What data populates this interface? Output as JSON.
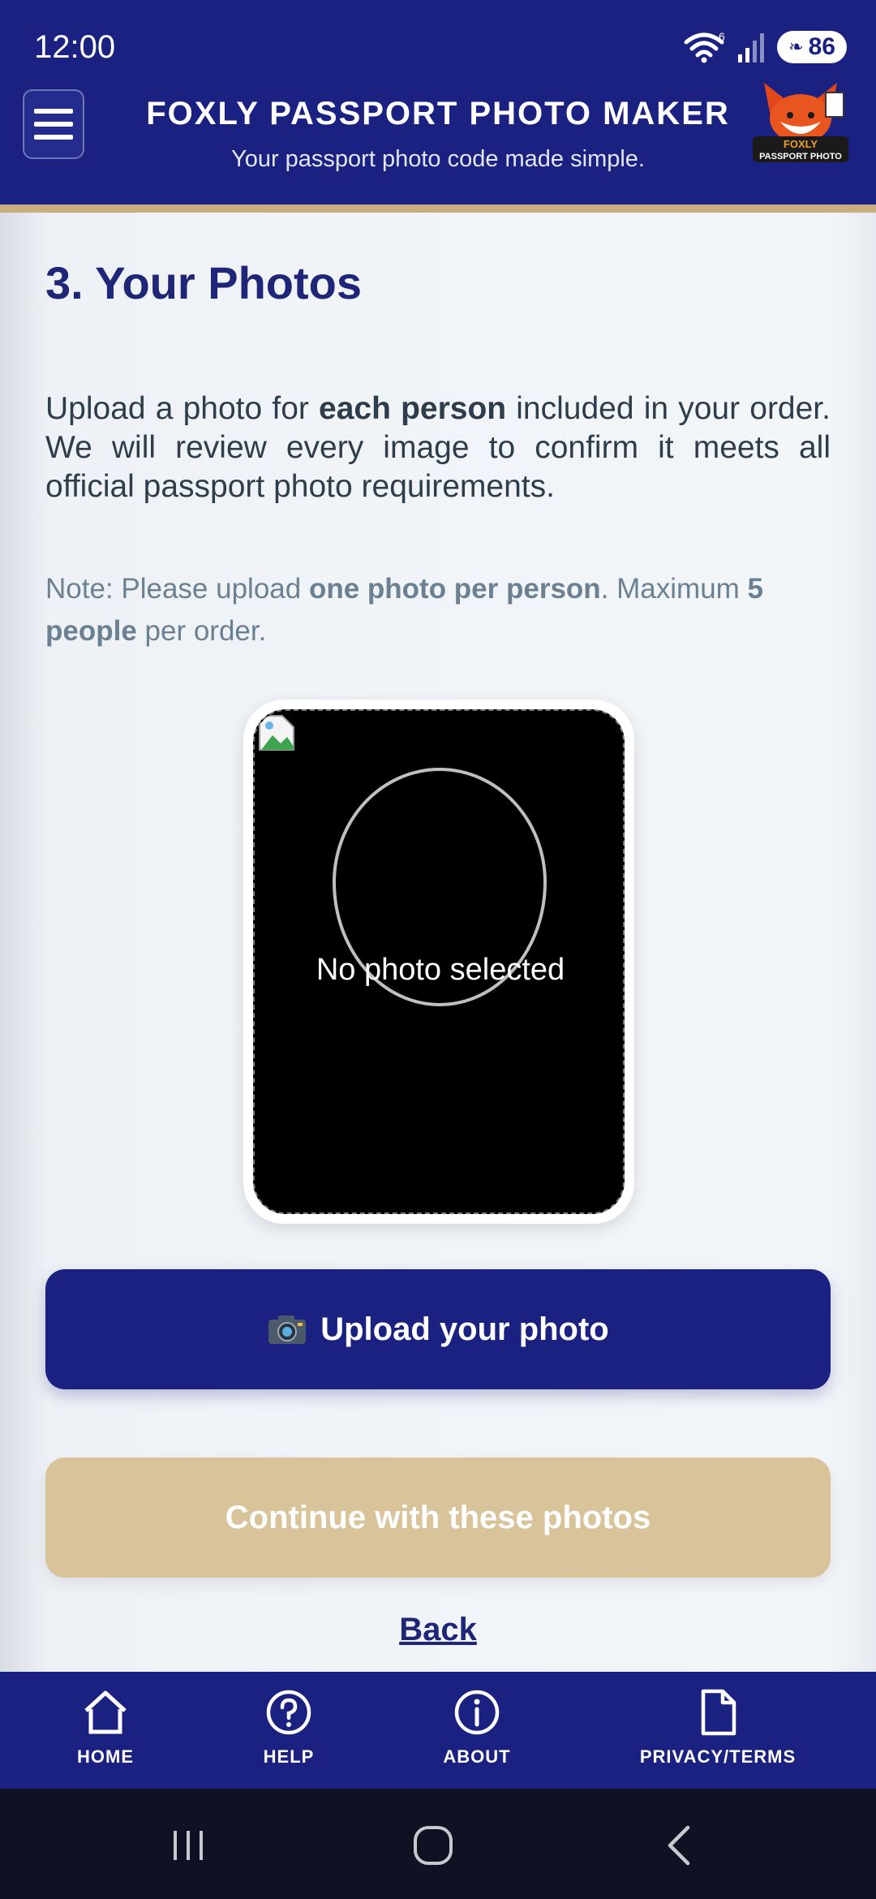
{
  "status_bar": {
    "time": "12:00",
    "wifi_badge": "6",
    "battery": "86"
  },
  "header": {
    "title": "FOXLY PASSPORT PHOTO MAKER",
    "subtitle": "Your passport photo code made simple.",
    "logo_text_top": "FOXLY",
    "logo_text_bottom": "PASSPORT PHOTO"
  },
  "main": {
    "title": "3. Your Photos",
    "intro_part1": "Upload a photo for ",
    "intro_bold": "each person",
    "intro_part2": " included in your order. We will review every image to confirm it meets all official passport photo requirements.",
    "note_part1": "Note: Please upload ",
    "note_bold1": "one photo per person",
    "note_part2": ". Maximum ",
    "note_bold2": "5 people",
    "note_part3": " per order.",
    "photo_placeholder": "No photo selected",
    "upload_label": "Upload your photo",
    "continue_label": "Continue with these photos",
    "back_label": "Back"
  },
  "bottom_nav": [
    {
      "label": "HOME",
      "icon": "home-icon"
    },
    {
      "label": "HELP",
      "icon": "help-icon"
    },
    {
      "label": "ABOUT",
      "icon": "info-icon"
    },
    {
      "label": "PRIVACY/TERMS",
      "icon": "document-icon"
    }
  ],
  "colors": {
    "primary": "#1b2180",
    "accent": "#c9ad80",
    "continue_disabled": "#d9c39b"
  }
}
